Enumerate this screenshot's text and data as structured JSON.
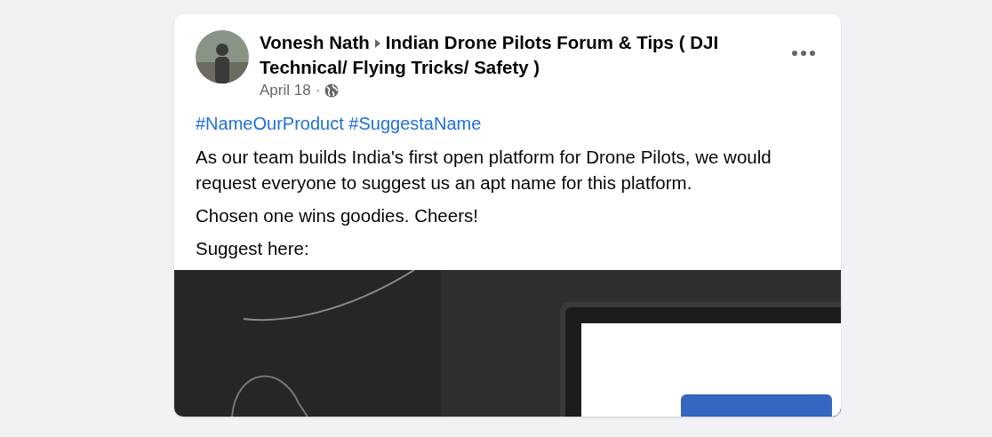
{
  "post": {
    "author": "Vonesh Nath",
    "group": "Indian Drone Pilots Forum & Tips ( DJI Technical/ Flying Tricks/ Safety )",
    "date": "April 18",
    "separator": "·",
    "hashtags": [
      "#NameOurProduct",
      "#SuggestaName"
    ],
    "paragraphs": [
      "As our team builds India's first open platform for Drone Pilots, we would request everyone to suggest us an apt name for this platform.",
      "Chosen one wins goodies. Cheers!",
      "Suggest here:"
    ],
    "attachment": {
      "kind": "picture"
    }
  }
}
